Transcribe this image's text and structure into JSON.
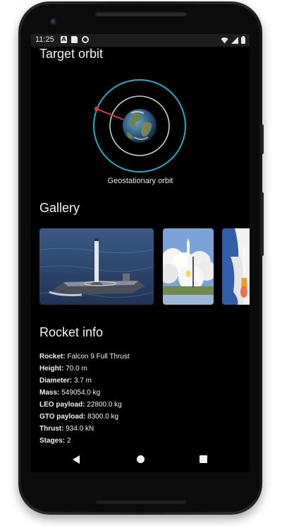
{
  "status_bar": {
    "time": "11:25",
    "icons_left": [
      "a-notification-icon",
      "sim-card-icon",
      "sync-icon"
    ],
    "icons_right": [
      "wifi-icon",
      "signal-icon",
      "battery-icon"
    ]
  },
  "target_orbit": {
    "title": "Target orbit",
    "orbit_name": "Geostationary orbit"
  },
  "gallery": {
    "title": "Gallery",
    "images": [
      "booster-landing-photo",
      "launch-photo",
      "launch-closeup-photo"
    ]
  },
  "rocket_info": {
    "title": "Rocket info",
    "rows": [
      {
        "label": "Rocket:",
        "value": "Falcon 9 Full Thrust"
      },
      {
        "label": "Height:",
        "value": "70.0 m"
      },
      {
        "label": "Diameter:",
        "value": "3.7 m"
      },
      {
        "label": "Mass:",
        "value": "549054.0 kg"
      },
      {
        "label": "LEO payload:",
        "value": "22800.0 kg"
      },
      {
        "label": "GTO payload:",
        "value": "8300.0 kg"
      },
      {
        "label": "Thrust:",
        "value": "934.0 kN"
      },
      {
        "label": "Stages:",
        "value": "2"
      }
    ]
  },
  "nav": {
    "back": "back-icon",
    "home": "home-icon",
    "recents": "recents-icon"
  },
  "colors": {
    "orbit_ring": "#1ab0c8",
    "inner_ring": "#cfcfcf",
    "marker": "#e0364a",
    "background": "#000000"
  }
}
